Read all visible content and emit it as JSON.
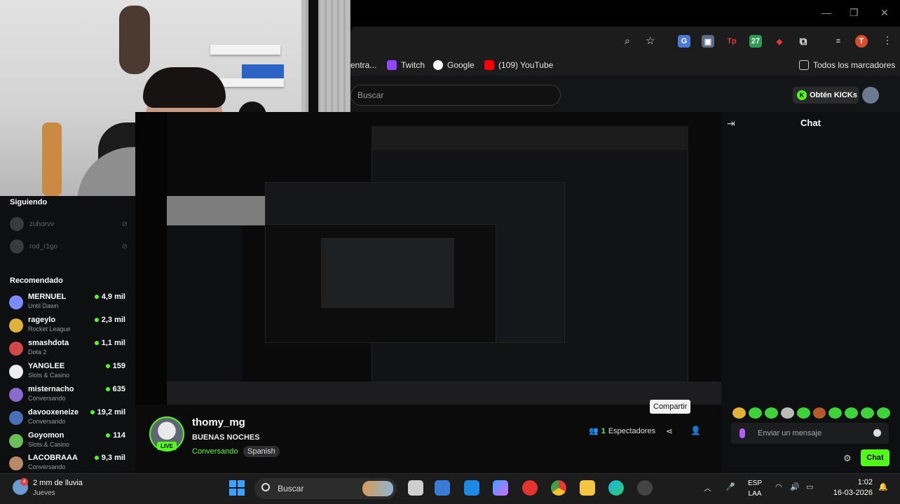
{
  "browser": {
    "window_controls": [
      "—",
      "❐",
      "✕"
    ],
    "bookmarks": [
      {
        "label": "entra...",
        "icon": "bookmark-icon",
        "color": "#5b5b5b"
      },
      {
        "label": "Twitch",
        "icon": "twitch-icon",
        "color": "#9146ff"
      },
      {
        "label": "Google",
        "icon": "google-icon",
        "color": "#ffffff"
      },
      {
        "label": "(109) YouTube",
        "icon": "youtube-icon",
        "color": "#ff0000"
      }
    ],
    "all_bookmarks_label": "Todos los marcadores",
    "profile_initial": "T"
  },
  "kick": {
    "search_placeholder": "Buscar",
    "get_kicks_label": "Obtén KICKs",
    "kick_glyph": "K"
  },
  "sidebar": {
    "following_title": "Siguiendo",
    "following": [
      {
        "name": "zuhorvv"
      },
      {
        "name": "rod_r1go"
      }
    ],
    "recommended_title": "Recomendado",
    "recommended": [
      {
        "name": "MERNUEL",
        "category": "Until Dawn",
        "viewers": "4,9 mil",
        "color": "#7a8cff"
      },
      {
        "name": "rageylo",
        "category": "Rocket League",
        "viewers": "2,3 mil",
        "color": "#e0b23a"
      },
      {
        "name": "smashdota",
        "category": "Dota 2",
        "viewers": "1,1 mil",
        "color": "#d24747"
      },
      {
        "name": "YANGLEE",
        "category": "Slots & Casino",
        "viewers": "159",
        "color": "#eeeeee"
      },
      {
        "name": "misternacho",
        "category": "Conversando",
        "viewers": "635",
        "color": "#8a6ad1"
      },
      {
        "name": "davooxeneize",
        "category": "Conversando",
        "viewers": "19,2 mil",
        "color": "#4a6fb5"
      },
      {
        "name": "Goyomon",
        "category": "Slots & Casino",
        "viewers": "114",
        "color": "#6bbf59"
      },
      {
        "name": "LACOBRAAA",
        "category": "Conversando",
        "viewers": "9,3 mil",
        "color": "#b88a6a"
      }
    ]
  },
  "chat": {
    "title": "Chat",
    "input_placeholder": "Enviar un mensaje",
    "send_label": "Chat",
    "accent": "#53fc18"
  },
  "stream": {
    "channel": "thomy_mg",
    "title": "BUENAS NOCHES",
    "category": "Conversando",
    "language": "Spanish",
    "live_label": "LIVE",
    "viewers_count": "1",
    "viewers_label": "Espectadores",
    "share_tooltip": "Compartir"
  },
  "taskbar": {
    "weather_text": "2 mm de lluvia",
    "weather_day": "Jueves",
    "weather_badge": "4",
    "search_label": "Buscar",
    "keyboard_lang": "ESP",
    "keyboard_layout": "LAA",
    "time": "1:02",
    "date": "16-03-2026"
  }
}
